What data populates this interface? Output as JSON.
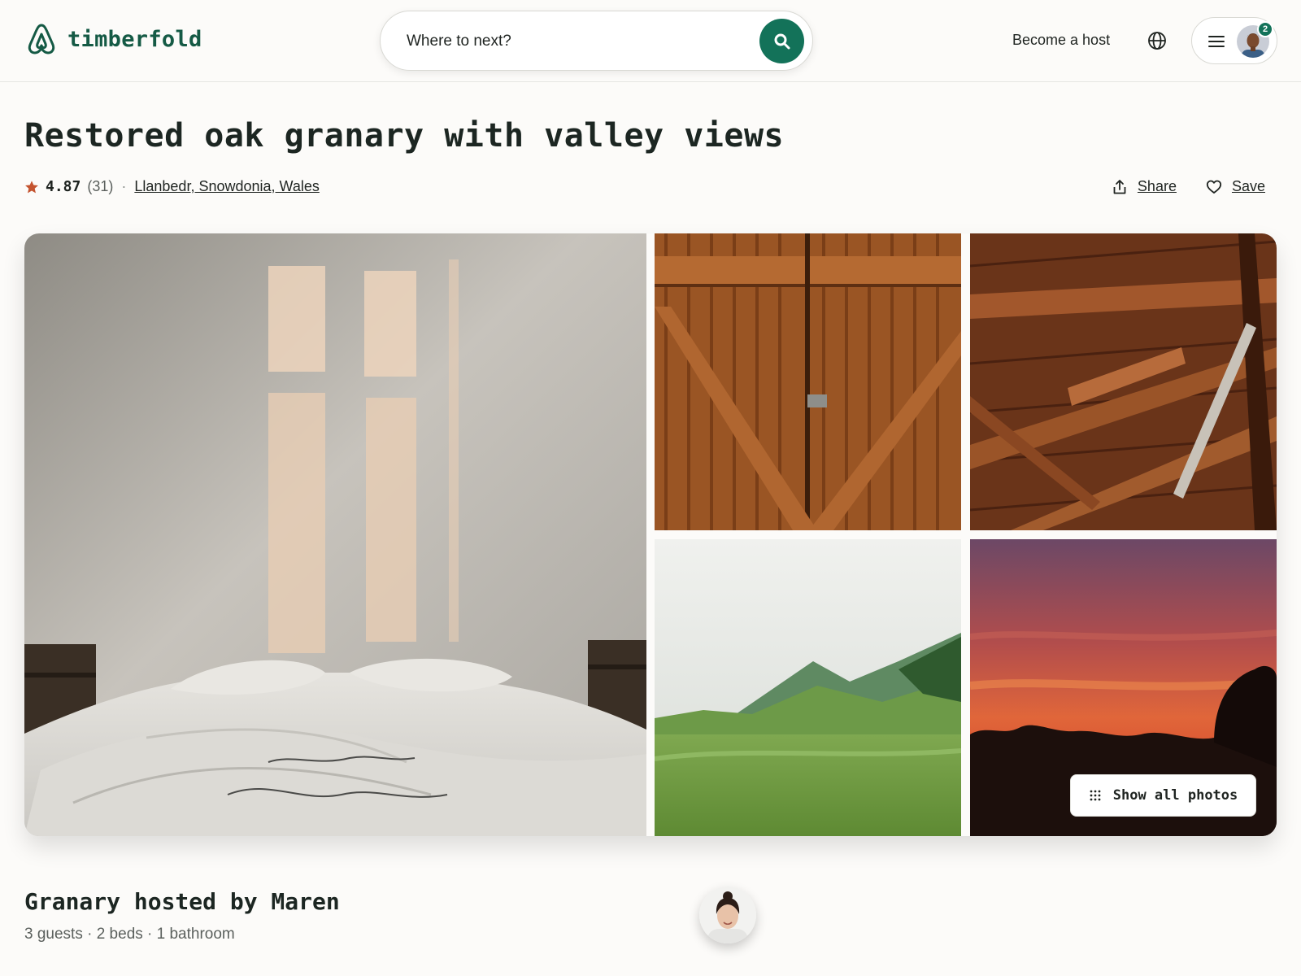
{
  "header": {
    "brand": "timberfold",
    "search_placeholder": "Where to next?",
    "host_link": "Become a host",
    "notification_count": "2",
    "accent_color": "#137259"
  },
  "listing": {
    "title": "Restored oak granary with valley views",
    "rating": "4.87",
    "reviews": "(31)",
    "separator": "·",
    "location": "Llanbedr, Snowdonia, Wales",
    "share_label": "Share",
    "save_label": "Save"
  },
  "gallery": {
    "photos": [
      "bedroom",
      "barn-door",
      "roof-beams",
      "green-hills",
      "sunset"
    ],
    "show_all_label": "Show all photos"
  },
  "host": {
    "title": "Granary hosted by Maren",
    "details": "3 guests · 2 beds · 1 bathroom"
  },
  "icons": [
    "logo-icon",
    "search-icon",
    "globe-icon",
    "hamburger-icon",
    "star-icon",
    "share-icon",
    "heart-icon",
    "grid-icon"
  ]
}
